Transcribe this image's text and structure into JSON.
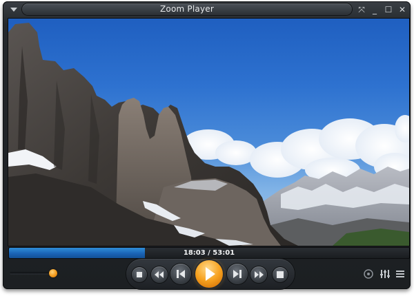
{
  "window": {
    "title": "Zoom Player"
  },
  "titlebar_buttons": {
    "menu": "chevron-down-icon",
    "fullscreen": "fullscreen-icon",
    "minimize": "minimize-icon",
    "maximize": "maximize-icon",
    "close": "close-icon",
    "fullscreen_glyph": "⤧",
    "minimize_glyph": "_",
    "maximize_glyph": "☐",
    "close_glyph": "✕"
  },
  "playback": {
    "time_display": "18:03 / 53:01",
    "progress_fraction": 0.34,
    "volume_fraction": 0.9
  },
  "transport": {
    "stop": "stop-icon",
    "rewind": "rewind-icon",
    "previous": "previous-icon",
    "play": "play-icon",
    "next": "next-icon",
    "fast_forward": "fast-forward-icon",
    "eject_stop": "stop-square-icon"
  },
  "colors": {
    "accent": "#f7a21f",
    "seek_fill": "#1a64b6",
    "chrome": "#1c1f22"
  }
}
